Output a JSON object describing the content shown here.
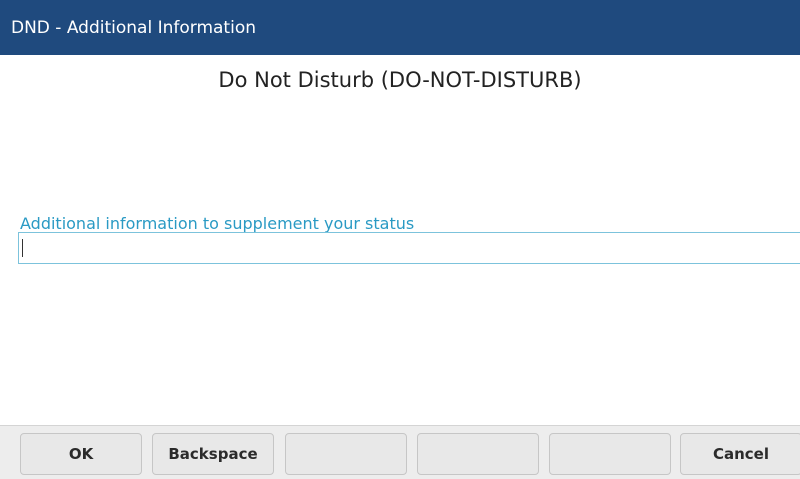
{
  "window": {
    "title": "DND - Additional Information"
  },
  "status": {
    "heading": "Do Not Disturb (DO-NOT-DISTURB)"
  },
  "info_field": {
    "label": "Additional information to supplement your status",
    "value": ""
  },
  "softkeys": [
    {
      "label": "OK"
    },
    {
      "label": "Backspace"
    },
    {
      "label": ""
    },
    {
      "label": ""
    },
    {
      "label": ""
    },
    {
      "label": "Cancel"
    }
  ],
  "colors": {
    "title_bar": "#1f4a7e",
    "label_accent": "#2a9ac4",
    "input_border": "#7cc3dc"
  }
}
